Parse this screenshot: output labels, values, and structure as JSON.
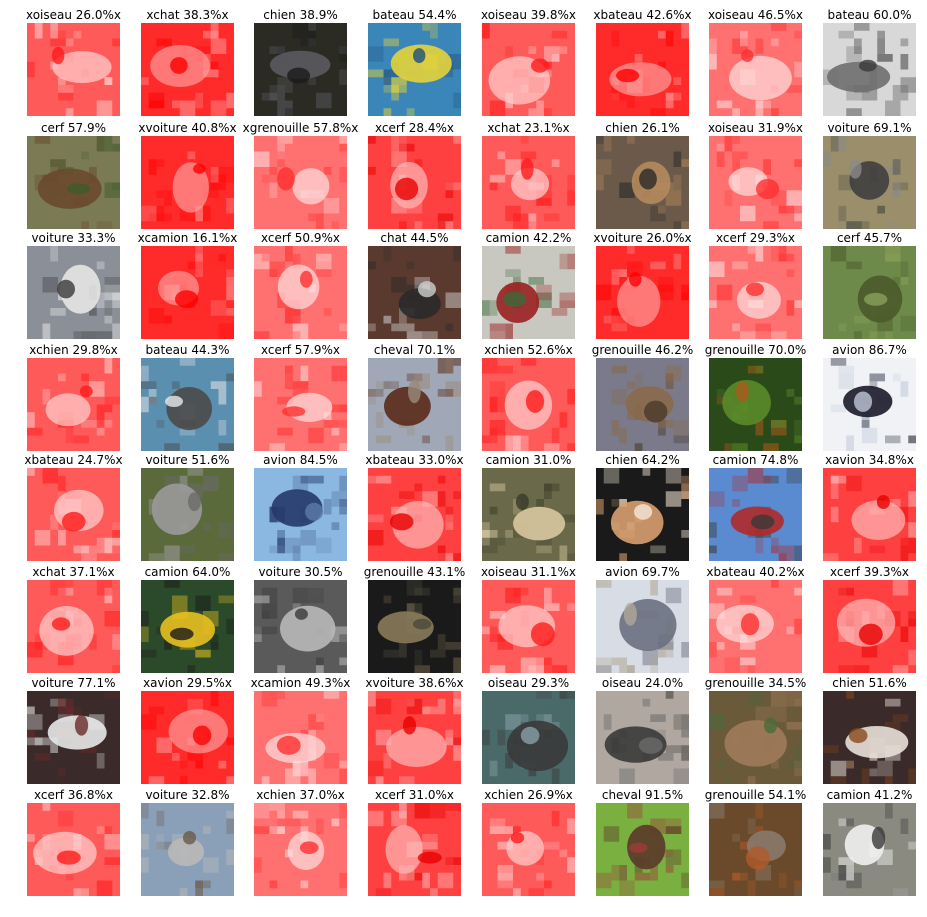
{
  "grid": {
    "rows": 8,
    "columns": 8,
    "misclassified_tint": "#ff0000",
    "cells": [
      {
        "caption": "xoiseau 26.0%x",
        "misclassified": true
      },
      {
        "caption": "xchat 38.3%x",
        "misclassified": true
      },
      {
        "caption": "chien 38.9%",
        "misclassified": false
      },
      {
        "caption": "bateau 54.4%",
        "misclassified": false
      },
      {
        "caption": "xoiseau 39.8%x",
        "misclassified": true
      },
      {
        "caption": "xbateau 42.6%x",
        "misclassified": true
      },
      {
        "caption": "xoiseau 46.5%x",
        "misclassified": true
      },
      {
        "caption": "bateau 60.0%",
        "misclassified": false
      },
      {
        "caption": "cerf 57.9%",
        "misclassified": false
      },
      {
        "caption": "xvoiture 40.8%x",
        "misclassified": true
      },
      {
        "caption": "xgrenouille 57.8%x",
        "misclassified": true
      },
      {
        "caption": "xcerf 28.4%x",
        "misclassified": true
      },
      {
        "caption": "xchat 23.1%x",
        "misclassified": true
      },
      {
        "caption": "chien 26.1%",
        "misclassified": false
      },
      {
        "caption": "xoiseau 31.9%x",
        "misclassified": true
      },
      {
        "caption": "voiture 69.1%",
        "misclassified": false
      },
      {
        "caption": "voiture 33.3%",
        "misclassified": false
      },
      {
        "caption": "xcamion 16.1%x",
        "misclassified": true
      },
      {
        "caption": "xcerf 50.9%x",
        "misclassified": true
      },
      {
        "caption": "chat 44.5%",
        "misclassified": false
      },
      {
        "caption": "camion 42.2%",
        "misclassified": false
      },
      {
        "caption": "xvoiture 26.0%x",
        "misclassified": true
      },
      {
        "caption": "xcerf 29.3%x",
        "misclassified": true
      },
      {
        "caption": "cerf 45.7%",
        "misclassified": false
      },
      {
        "caption": "xchien 29.8%x",
        "misclassified": true
      },
      {
        "caption": "bateau 44.3%",
        "misclassified": false
      },
      {
        "caption": "xcerf 57.9%x",
        "misclassified": true
      },
      {
        "caption": "cheval 70.1%",
        "misclassified": false
      },
      {
        "caption": "xchien 52.6%x",
        "misclassified": true
      },
      {
        "caption": "grenouille 46.2%",
        "misclassified": false
      },
      {
        "caption": "grenouille 70.0%",
        "misclassified": false
      },
      {
        "caption": "avion 86.7%",
        "misclassified": false
      },
      {
        "caption": "xbateau 24.7%x",
        "misclassified": true
      },
      {
        "caption": "voiture 51.6%",
        "misclassified": false
      },
      {
        "caption": "avion 84.5%",
        "misclassified": false
      },
      {
        "caption": "xbateau 33.0%x",
        "misclassified": true
      },
      {
        "caption": "camion 31.0%",
        "misclassified": false
      },
      {
        "caption": "chien 64.2%",
        "misclassified": false
      },
      {
        "caption": "camion 74.8%",
        "misclassified": false
      },
      {
        "caption": "xavion 34.8%x",
        "misclassified": true
      },
      {
        "caption": "xchat 37.1%x",
        "misclassified": true
      },
      {
        "caption": "camion 64.0%",
        "misclassified": false
      },
      {
        "caption": "voiture 30.5%",
        "misclassified": false
      },
      {
        "caption": "grenouille 43.1%",
        "misclassified": false
      },
      {
        "caption": "xoiseau 31.1%x",
        "misclassified": true
      },
      {
        "caption": "avion 69.7%",
        "misclassified": false
      },
      {
        "caption": "xbateau 40.2%x",
        "misclassified": true
      },
      {
        "caption": "xcerf 39.3%x",
        "misclassified": true
      },
      {
        "caption": "voiture 77.1%",
        "misclassified": false
      },
      {
        "caption": "xavion 29.5%x",
        "misclassified": true
      },
      {
        "caption": "xcamion 49.3%x",
        "misclassified": true
      },
      {
        "caption": "xvoiture 38.6%x",
        "misclassified": true
      },
      {
        "caption": "oiseau 29.3%",
        "misclassified": false
      },
      {
        "caption": "oiseau 24.0%",
        "misclassified": false
      },
      {
        "caption": "grenouille 34.5%",
        "misclassified": false
      },
      {
        "caption": "chien 51.6%",
        "misclassified": false
      },
      {
        "caption": "xcerf 36.8%x",
        "misclassified": true
      },
      {
        "caption": "voiture 32.8%",
        "misclassified": false
      },
      {
        "caption": "xchien 37.0%x",
        "misclassified": true
      },
      {
        "caption": "xcerf 31.0%x",
        "misclassified": true
      },
      {
        "caption": "xchien 26.9%x",
        "misclassified": true
      },
      {
        "caption": "cheval 91.5%",
        "misclassified": false
      },
      {
        "caption": "grenouille 54.1%",
        "misclassified": false
      },
      {
        "caption": "camion 41.2%",
        "misclassified": false
      }
    ]
  }
}
